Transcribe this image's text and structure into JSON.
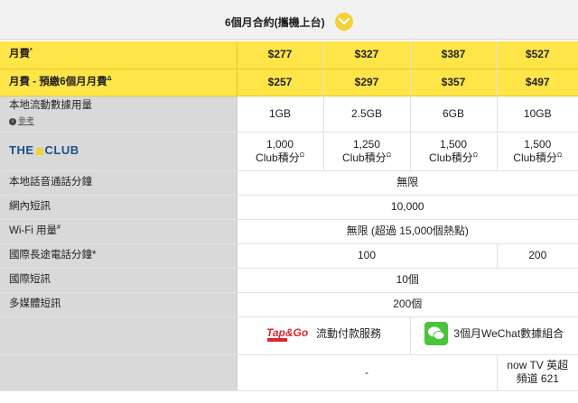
{
  "header": {
    "title": "6個月合約(攜機上台)"
  },
  "plans": {
    "monthly_fee": {
      "label": "月費",
      "sup": "*",
      "values": [
        "$277",
        "$327",
        "$387",
        "$527"
      ]
    },
    "prepay_fee": {
      "label": "月費 - 預繳6個月月費",
      "sup": "Δ",
      "values": [
        "$257",
        "$297",
        "$357",
        "$497"
      ]
    },
    "data": {
      "label": "本地流動數據用量",
      "ref_label": "參考",
      "values": [
        "1GB",
        "2.5GB",
        "6GB",
        "10GB"
      ]
    },
    "club": {
      "logo_left": "THE",
      "logo_right": "CLUB",
      "values": [
        "1,000",
        "1,250",
        "1,500",
        "1,500"
      ],
      "unit": "Club積分",
      "sup": "Ω"
    },
    "voice": {
      "label": "本地話音通話分鐘",
      "value": "無限"
    },
    "sms": {
      "label": "網內短訊",
      "value": "10,000"
    },
    "wifi": {
      "label": "Wi-Fi 用量",
      "sup": "#",
      "value": "無限 (超過 15,000個熱點)"
    },
    "idd": {
      "label": "國際長途電話分鐘*",
      "value_a": "100",
      "value_b": "200"
    },
    "intl_sms": {
      "label": "國際短訊",
      "value": "10個"
    },
    "mms": {
      "label": "多媒體短訊",
      "value": "200個"
    },
    "extras": {
      "tapgo_text": "流動付款服務",
      "tapgo_logo": "Tap&Go",
      "wechat_text": "3個月WeChat數據組合",
      "dash": "-",
      "nowtv": "now TV 英超頻道 621"
    }
  },
  "colors": {
    "yellow": "#ffe547",
    "accent": "#f3d23a",
    "label_bg": "#d9d9d9",
    "club_blue": "#1d4f8c",
    "wechat_green": "#4bc43c"
  }
}
